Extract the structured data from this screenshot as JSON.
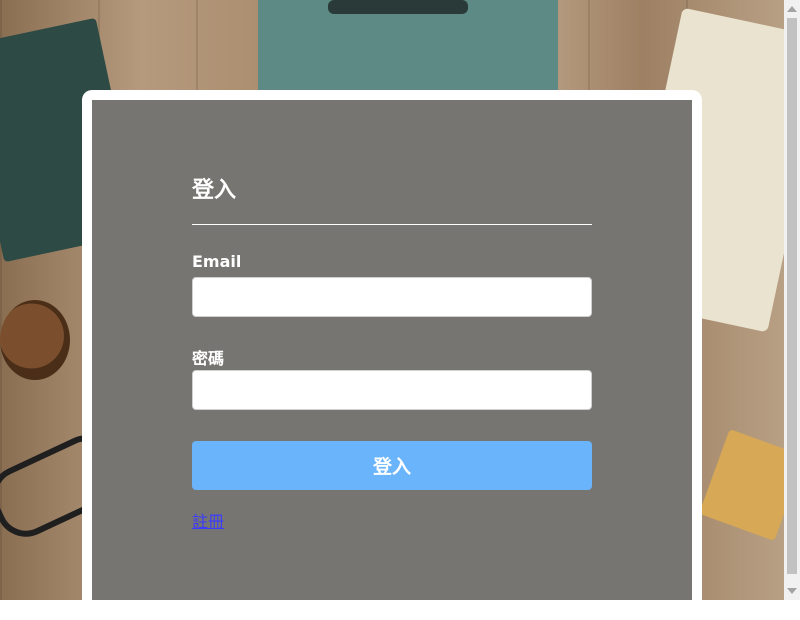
{
  "login": {
    "title": "登入",
    "email_label": "Email",
    "email_value": "",
    "password_label": "密碼",
    "password_value": "",
    "submit_label": "登入",
    "register_link": "註冊"
  },
  "colors": {
    "button": "#6ab4fb",
    "link": "#3b3bff",
    "card": "#ffffff"
  }
}
